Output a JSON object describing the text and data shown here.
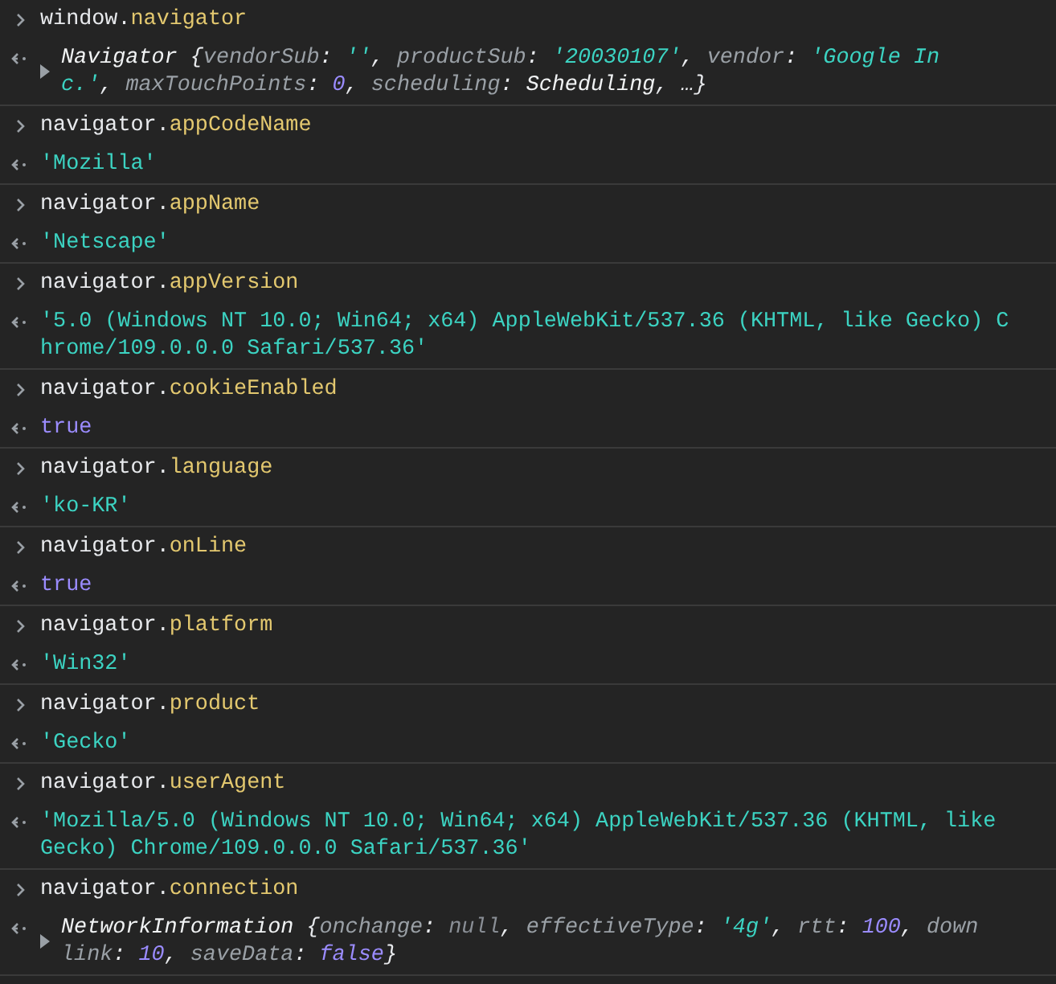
{
  "entries": [
    {
      "input": [
        {
          "text": "window.",
          "kind": "plain"
        },
        {
          "text": "navigator",
          "kind": "property"
        }
      ],
      "result": {
        "kind": "object",
        "expanded": false,
        "tokens": [
          {
            "text": "Navigator ",
            "kind": "class"
          },
          {
            "text": "{",
            "kind": "punct"
          },
          {
            "text": "vendorSub",
            "kind": "key"
          },
          {
            "text": ": ",
            "kind": "punct"
          },
          {
            "text": "''",
            "kind": "string"
          },
          {
            "text": ", ",
            "kind": "punct"
          },
          {
            "text": "productSub",
            "kind": "key"
          },
          {
            "text": ": ",
            "kind": "punct"
          },
          {
            "text": "'20030107'",
            "kind": "string"
          },
          {
            "text": ", ",
            "kind": "punct"
          },
          {
            "text": "vendor",
            "kind": "key"
          },
          {
            "text": ": ",
            "kind": "punct"
          },
          {
            "text": "'Google Inc.'",
            "kind": "string"
          },
          {
            "text": ", ",
            "kind": "punct"
          },
          {
            "text": "maxTouchPoints",
            "kind": "key"
          },
          {
            "text": ": ",
            "kind": "punct"
          },
          {
            "text": "0",
            "kind": "number"
          },
          {
            "text": ", ",
            "kind": "punct"
          },
          {
            "text": "scheduling",
            "kind": "key"
          },
          {
            "text": ": ",
            "kind": "punct"
          },
          {
            "text": "Scheduling",
            "kind": "class"
          },
          {
            "text": ", …}",
            "kind": "punct"
          }
        ]
      }
    },
    {
      "input": [
        {
          "text": "navigator.",
          "kind": "plain"
        },
        {
          "text": "appCodeName",
          "kind": "property"
        }
      ],
      "result": {
        "kind": "value",
        "tokens": [
          {
            "text": "'Mozilla'",
            "kind": "string"
          }
        ]
      }
    },
    {
      "input": [
        {
          "text": "navigator.",
          "kind": "plain"
        },
        {
          "text": "appName",
          "kind": "property"
        }
      ],
      "result": {
        "kind": "value",
        "tokens": [
          {
            "text": "'Netscape'",
            "kind": "string"
          }
        ]
      }
    },
    {
      "input": [
        {
          "text": "navigator.",
          "kind": "plain"
        },
        {
          "text": "appVersion",
          "kind": "property"
        }
      ],
      "result": {
        "kind": "value",
        "tokens": [
          {
            "text": "'5.0 (Windows NT 10.0; Win64; x64) AppleWebKit/537.36 (KHTML, like Gecko) Chrome/109.0.0.0 Safari/537.36'",
            "kind": "string"
          }
        ]
      }
    },
    {
      "input": [
        {
          "text": "navigator.",
          "kind": "plain"
        },
        {
          "text": "cookieEnabled",
          "kind": "property"
        }
      ],
      "result": {
        "kind": "value",
        "tokens": [
          {
            "text": "true",
            "kind": "boolean"
          }
        ]
      }
    },
    {
      "input": [
        {
          "text": "navigator.",
          "kind": "plain"
        },
        {
          "text": "language",
          "kind": "property"
        }
      ],
      "result": {
        "kind": "value",
        "tokens": [
          {
            "text": "'ko-KR'",
            "kind": "string"
          }
        ]
      }
    },
    {
      "input": [
        {
          "text": "navigator.",
          "kind": "plain"
        },
        {
          "text": "onLine",
          "kind": "property"
        }
      ],
      "result": {
        "kind": "value",
        "tokens": [
          {
            "text": "true",
            "kind": "boolean"
          }
        ]
      }
    },
    {
      "input": [
        {
          "text": "navigator.",
          "kind": "plain"
        },
        {
          "text": "platform",
          "kind": "property"
        }
      ],
      "result": {
        "kind": "value",
        "tokens": [
          {
            "text": "'Win32'",
            "kind": "string"
          }
        ]
      }
    },
    {
      "input": [
        {
          "text": "navigator.",
          "kind": "plain"
        },
        {
          "text": "product",
          "kind": "property"
        }
      ],
      "result": {
        "kind": "value",
        "tokens": [
          {
            "text": "'Gecko'",
            "kind": "string"
          }
        ]
      }
    },
    {
      "input": [
        {
          "text": "navigator.",
          "kind": "plain"
        },
        {
          "text": "userAgent",
          "kind": "property"
        }
      ],
      "result": {
        "kind": "value",
        "tokens": [
          {
            "text": "'Mozilla/5.0 (Windows NT 10.0; Win64; x64) AppleWebKit/537.36 (KHTML, like Gecko) Chrome/109.0.0.0 Safari/537.36'",
            "kind": "string"
          }
        ]
      }
    },
    {
      "input": [
        {
          "text": "navigator.",
          "kind": "plain"
        },
        {
          "text": "connection",
          "kind": "property"
        }
      ],
      "result": {
        "kind": "object",
        "expanded": false,
        "tokens": [
          {
            "text": "NetworkInformation ",
            "kind": "class"
          },
          {
            "text": "{",
            "kind": "punct"
          },
          {
            "text": "onchange",
            "kind": "key"
          },
          {
            "text": ": ",
            "kind": "punct"
          },
          {
            "text": "null",
            "kind": "null"
          },
          {
            "text": ", ",
            "kind": "punct"
          },
          {
            "text": "effectiveType",
            "kind": "key"
          },
          {
            "text": ": ",
            "kind": "punct"
          },
          {
            "text": "'4g'",
            "kind": "string"
          },
          {
            "text": ", ",
            "kind": "punct"
          },
          {
            "text": "rtt",
            "kind": "key"
          },
          {
            "text": ": ",
            "kind": "punct"
          },
          {
            "text": "100",
            "kind": "number"
          },
          {
            "text": ", ",
            "kind": "punct"
          },
          {
            "text": "downlink",
            "kind": "key"
          },
          {
            "text": ": ",
            "kind": "punct"
          },
          {
            "text": "10",
            "kind": "number"
          },
          {
            "text": ", ",
            "kind": "punct"
          },
          {
            "text": "saveData",
            "kind": "key"
          },
          {
            "text": ": ",
            "kind": "punct"
          },
          {
            "text": "false",
            "kind": "boolean"
          },
          {
            "text": "}",
            "kind": "punct"
          }
        ]
      }
    }
  ]
}
